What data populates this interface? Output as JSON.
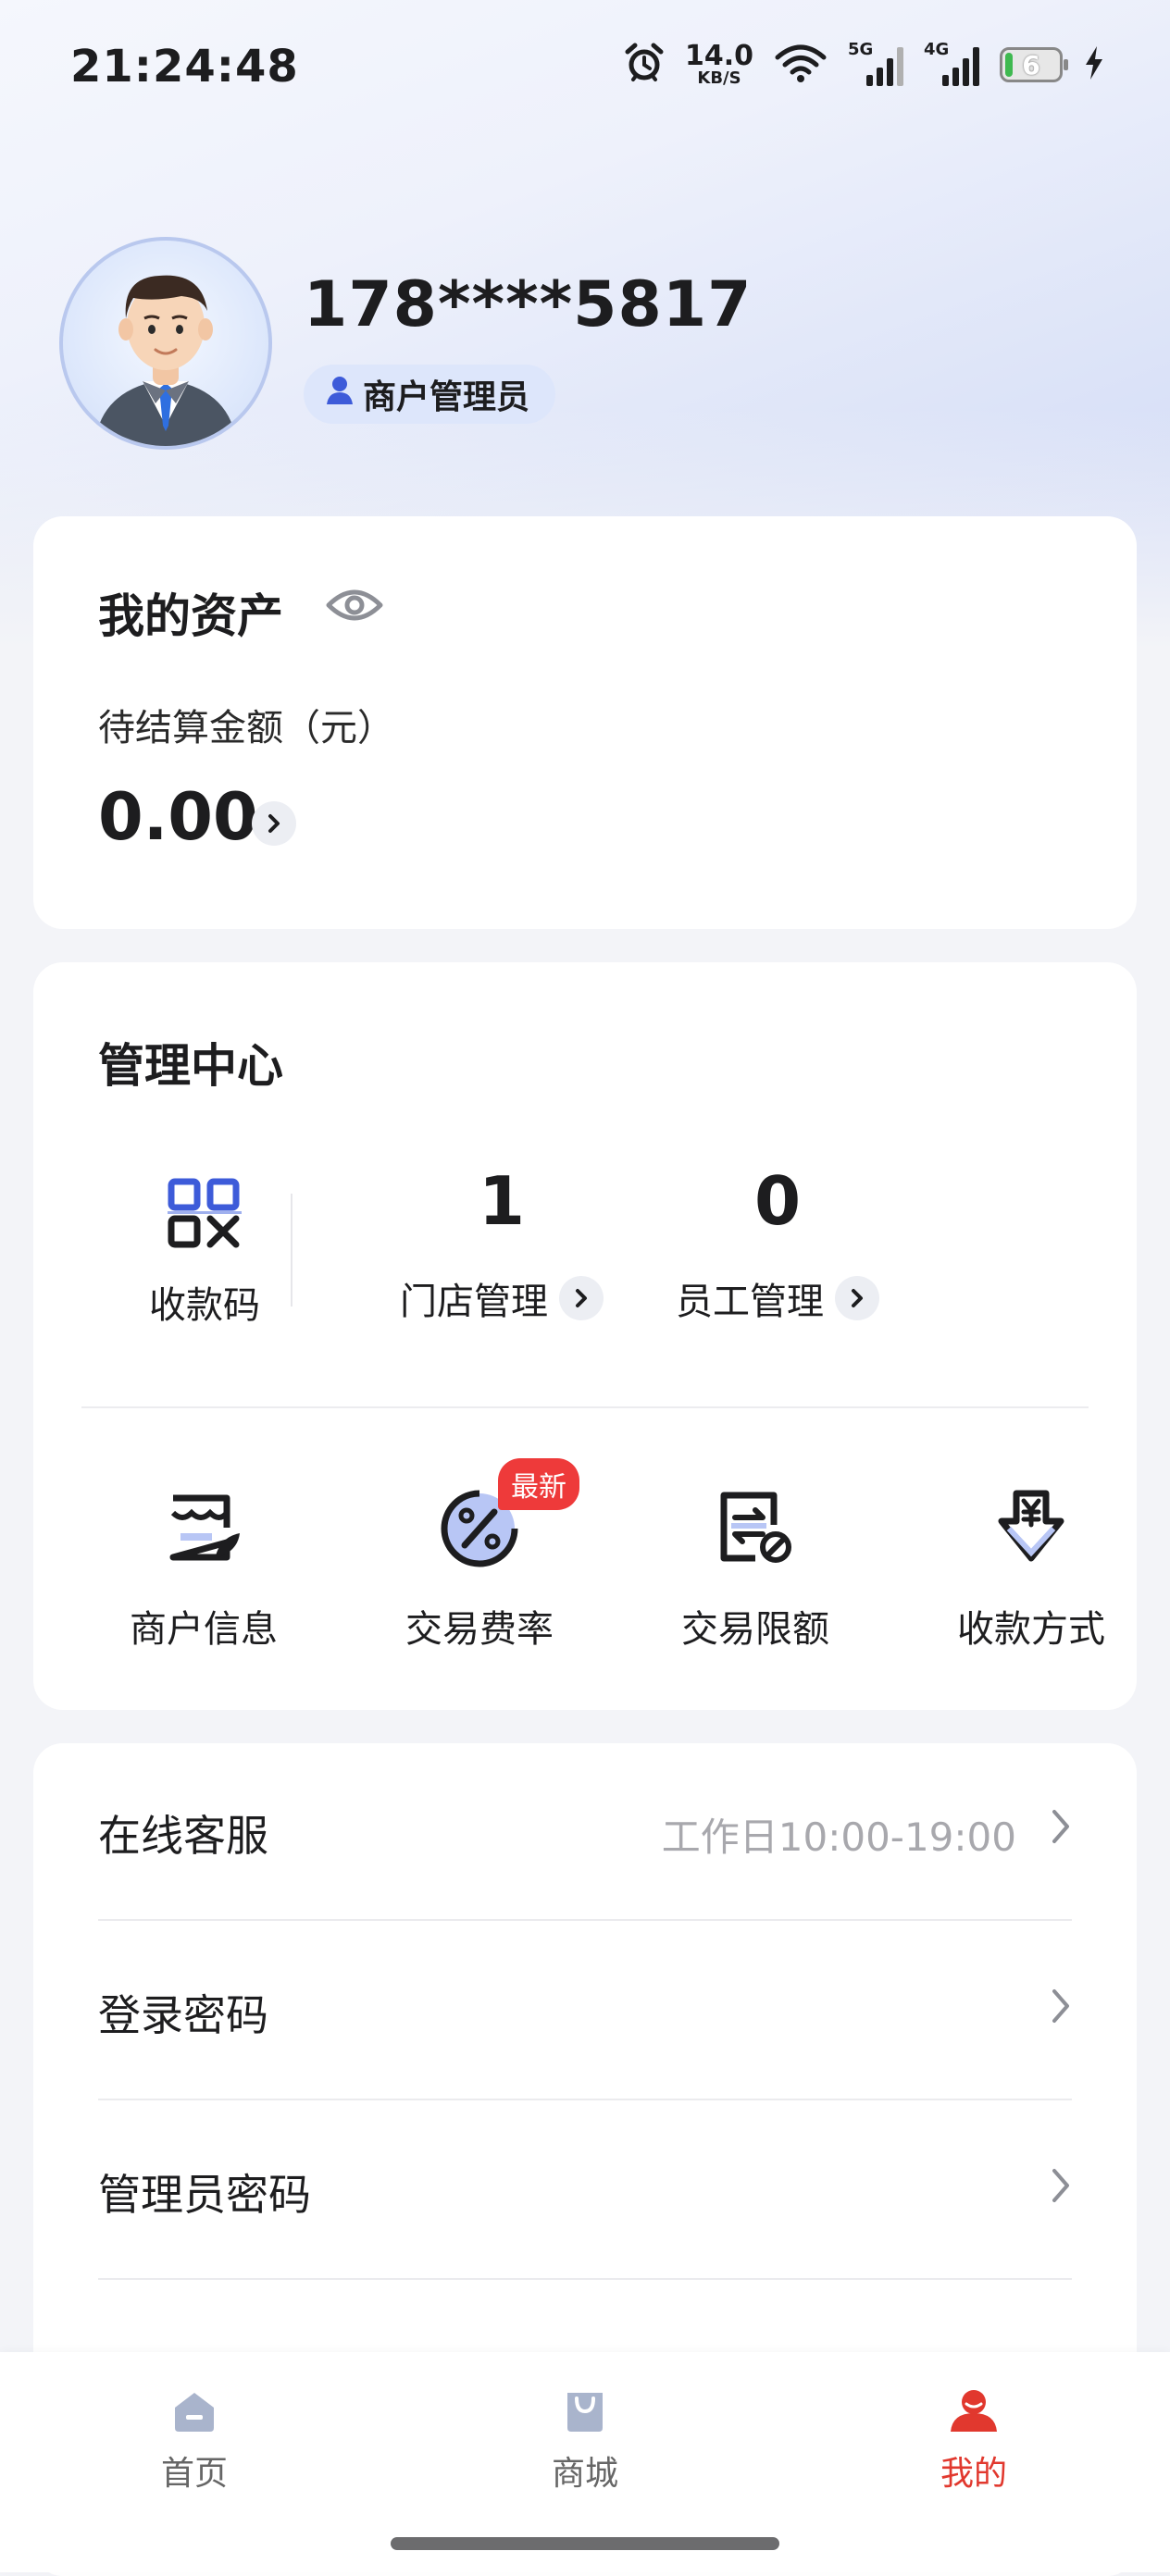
{
  "status_bar": {
    "time": "21:24:48",
    "net_speed_value": "14.0",
    "net_speed_unit": "KB/S",
    "sim1_type": "5G",
    "sim2_type": "4G",
    "battery_level": "6"
  },
  "profile": {
    "phone": "178****5817",
    "role": "商户管理员"
  },
  "assets": {
    "title": "我的资产",
    "pending_label": "待结算金额（元）",
    "pending_amount": "0.00"
  },
  "management": {
    "title": "管理中心",
    "qr_label": "收款码",
    "store_count": "1",
    "store_label": "门店管理",
    "staff_count": "0",
    "staff_label": "员工管理",
    "grid": [
      {
        "label": "商户信息"
      },
      {
        "label": "交易费率",
        "badge": "最新"
      },
      {
        "label": "交易限额"
      },
      {
        "label": "收款方式"
      }
    ]
  },
  "settings": {
    "rows": [
      {
        "label": "在线客服",
        "hint": "工作日10:00-19:00"
      },
      {
        "label": "登录密码"
      },
      {
        "label": "管理员密码"
      }
    ]
  },
  "tabbar": {
    "tabs": [
      {
        "label": "首页"
      },
      {
        "label": "商城"
      },
      {
        "label": "我的"
      }
    ],
    "active_color": "#e1382e",
    "inactive_icon_color": "#a9b4cc"
  },
  "colors": {
    "accent_blue": "#3d5bd9",
    "badge_red": "#ee3a3a"
  }
}
